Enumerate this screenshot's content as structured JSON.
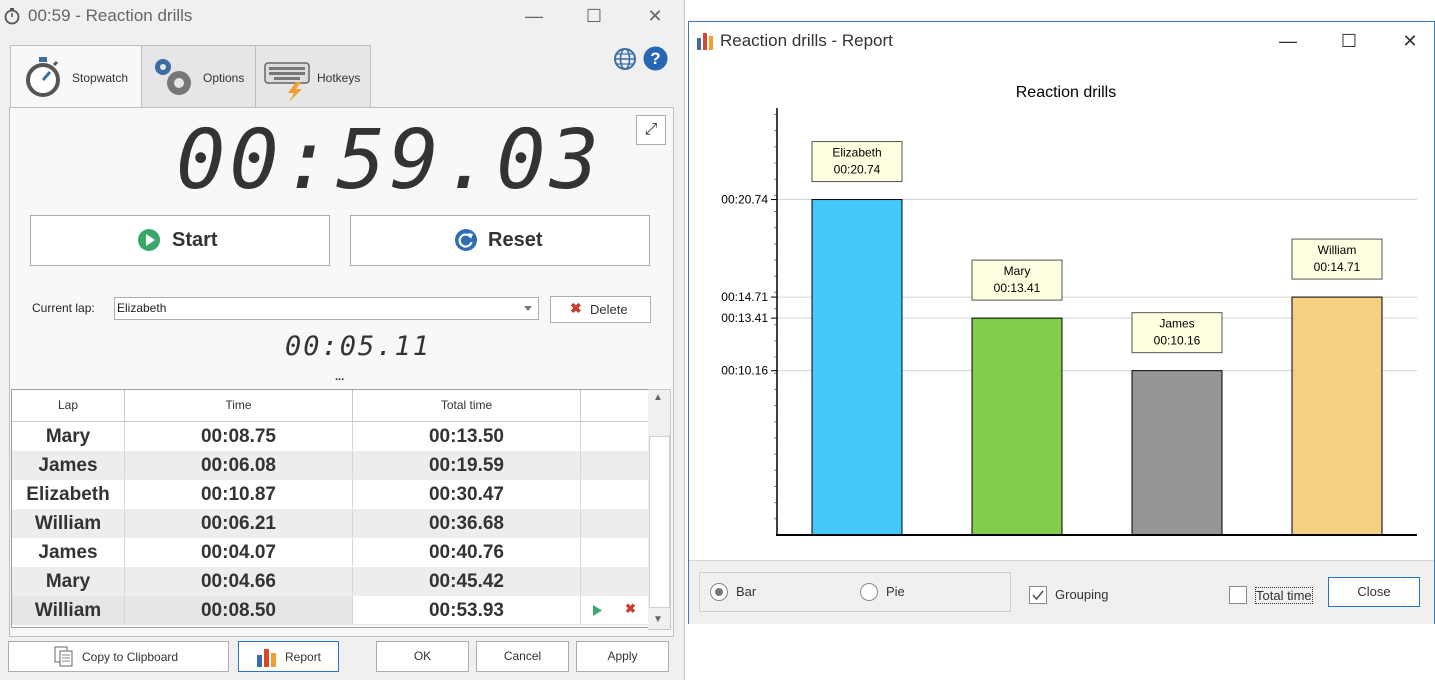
{
  "main_window": {
    "title": "00:59 - Reaction drills",
    "tabs": [
      {
        "label": "Stopwatch"
      },
      {
        "label": "Options"
      },
      {
        "label": "Hotkeys"
      }
    ],
    "stopwatch_display": "00:59.03",
    "start_label": "Start",
    "reset_label": "Reset",
    "current_lap_label": "Current lap:",
    "current_lap_value": "Elizabeth",
    "delete_label": "Delete",
    "lap_time_display": "00:05.11",
    "ellipsis": "...",
    "table": {
      "headers": [
        "Lap",
        "Time",
        "Total time",
        ""
      ],
      "rows": [
        {
          "lap": "Mary",
          "time": "00:08.75",
          "total": "00:13.50"
        },
        {
          "lap": "James",
          "time": "00:06.08",
          "total": "00:19.59"
        },
        {
          "lap": "Elizabeth",
          "time": "00:10.87",
          "total": "00:30.47"
        },
        {
          "lap": "William",
          "time": "00:06.21",
          "total": "00:36.68"
        },
        {
          "lap": "James",
          "time": "00:04.07",
          "total": "00:40.76"
        },
        {
          "lap": "Mary",
          "time": "00:04.66",
          "total": "00:45.42"
        },
        {
          "lap": "William",
          "time": "00:08.50",
          "total": "00:53.93"
        }
      ]
    },
    "bottom_buttons": {
      "copy": "Copy to Clipboard",
      "report": "Report",
      "ok": "OK",
      "cancel": "Cancel",
      "apply": "Apply"
    }
  },
  "report_window": {
    "title": "Reaction drills - Report",
    "footer": {
      "bar_label": "Bar",
      "pie_label": "Pie",
      "grouping_label": "Grouping",
      "total_time_label": "Total time",
      "close_label": "Close",
      "bar_selected": true,
      "grouping_checked": true,
      "total_time_checked": false
    }
  },
  "chart_data": {
    "type": "bar",
    "title": "Reaction drills",
    "categories": [
      "Elizabeth",
      "Mary",
      "James",
      "William"
    ],
    "values": [
      20.74,
      13.41,
      10.16,
      14.71
    ],
    "value_labels": [
      "00:20.74",
      "00:13.41",
      "00:10.16",
      "00:14.71"
    ],
    "colors": [
      "#45c8fc",
      "#84cc4c",
      "#969696",
      "#f6d082"
    ],
    "ytick_values": [
      10.16,
      13.41,
      14.71,
      20.74
    ],
    "ytick_labels": [
      "00:10.16",
      "00:13.41",
      "00:14.71",
      "00:20.74"
    ],
    "ylim": [
      0,
      26.4
    ],
    "legend": "none",
    "grid": true
  }
}
